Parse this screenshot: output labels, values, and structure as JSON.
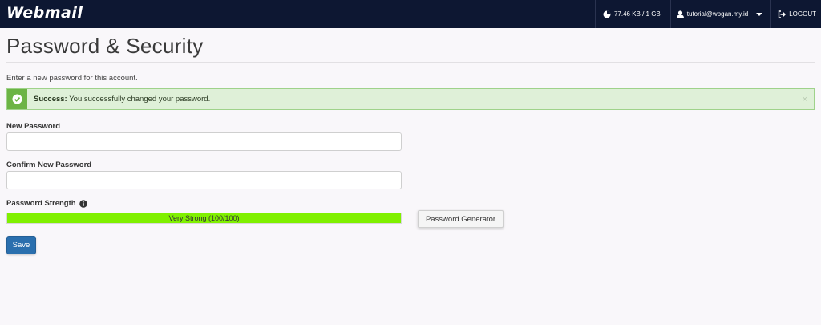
{
  "header": {
    "brand": "Webmail",
    "disk_usage": "77.46 KB / 1 GB",
    "user": "tutorial@wpgan.my.id",
    "logout": "LOGOUT"
  },
  "page": {
    "title": "Password & Security",
    "intro": "Enter a new password for this account."
  },
  "alert": {
    "strong": "Success:",
    "message": "You successfully changed your password.",
    "close": "×",
    "color": "#dff0d8"
  },
  "form": {
    "new_password_label": "New Password",
    "new_password_value": "",
    "confirm_password_label": "Confirm New Password",
    "confirm_password_value": "",
    "strength_label": "Password Strength",
    "strength_text": "Very Strong (100/100)",
    "strength_value": 100,
    "generator_label": "Password Generator",
    "save_label": "Save"
  },
  "colors": {
    "topbar": "#0d1732",
    "strength_bar": "#80f000",
    "save_button": "#2a6fae"
  }
}
